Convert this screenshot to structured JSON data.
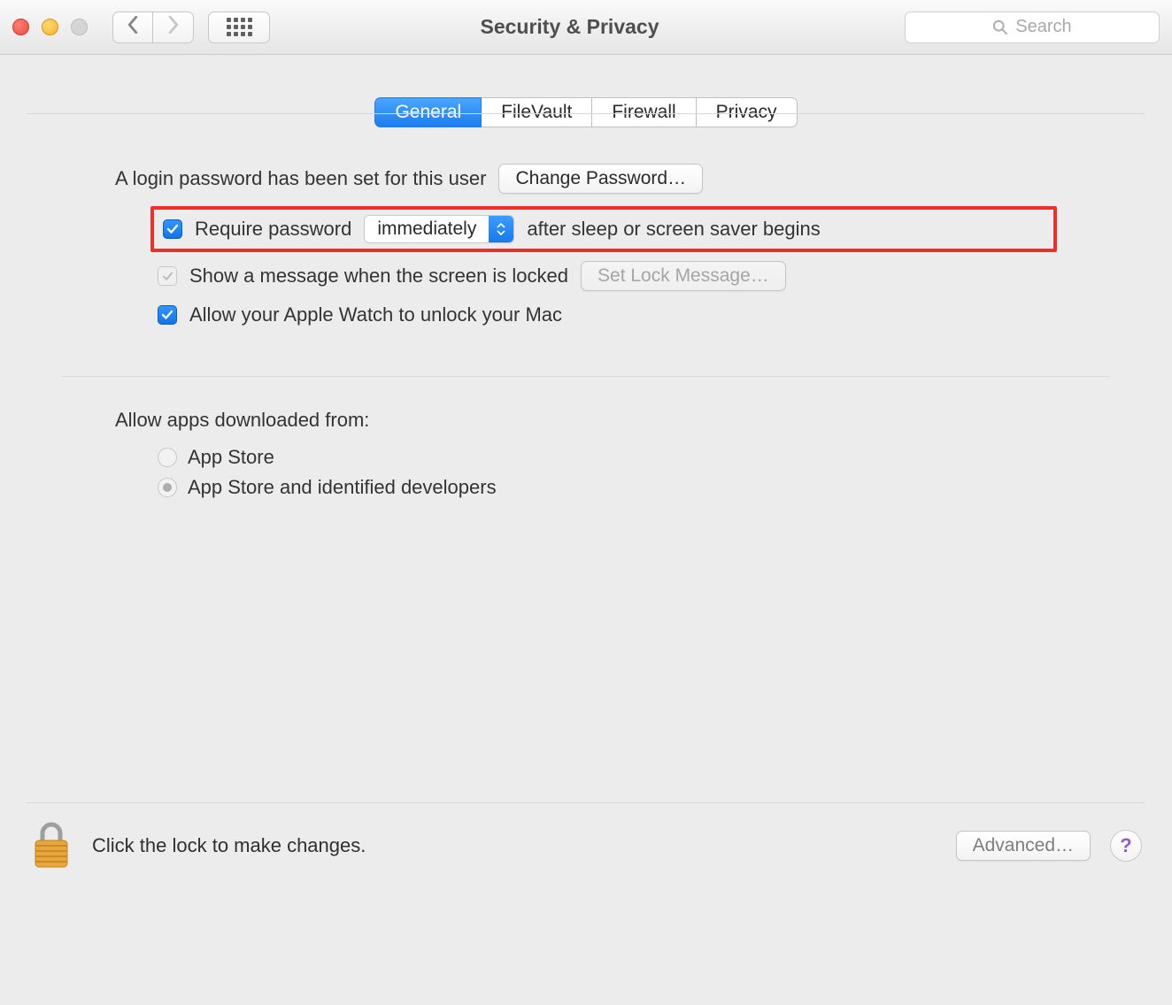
{
  "toolbar": {
    "title": "Security & Privacy",
    "search_placeholder": "Search"
  },
  "tabs": [
    {
      "label": "General",
      "active": true
    },
    {
      "label": "FileVault",
      "active": false
    },
    {
      "label": "Firewall",
      "active": false
    },
    {
      "label": "Privacy",
      "active": false
    }
  ],
  "general": {
    "login_password_text": "A login password has been set for this user",
    "change_password_button": "Change Password…",
    "require_password_pre": "Require password",
    "require_password_dropdown": "immediately",
    "require_password_post": "after sleep or screen saver begins",
    "show_message_label": "Show a message when the screen is locked",
    "set_lock_message_button": "Set Lock Message…",
    "apple_watch_label": "Allow your Apple Watch to unlock your Mac",
    "allow_apps_heading": "Allow apps downloaded from:",
    "allow_apps_options": [
      "App Store",
      "App Store and identified developers"
    ],
    "allow_apps_selected_index": 1
  },
  "footer": {
    "lock_text": "Click the lock to make changes.",
    "advanced_button": "Advanced…",
    "help_label": "?"
  }
}
